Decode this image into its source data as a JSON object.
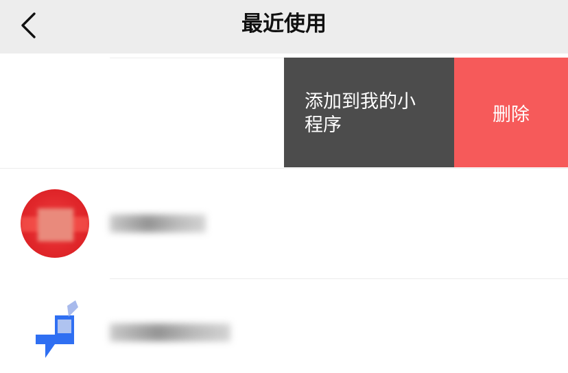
{
  "header": {
    "title": "最近使用",
    "back_icon": "chevron-left-icon"
  },
  "swipe_actions": {
    "add_label": "添加到我的小程序",
    "delete_label": "删除",
    "colors": {
      "add_bg": "#4c4c4c",
      "delete_bg": "#f65a5a"
    }
  },
  "items": [
    {
      "name": "",
      "icon": "red-circle-app-icon"
    },
    {
      "name": "",
      "icon": "blue-tencent-icon"
    }
  ]
}
